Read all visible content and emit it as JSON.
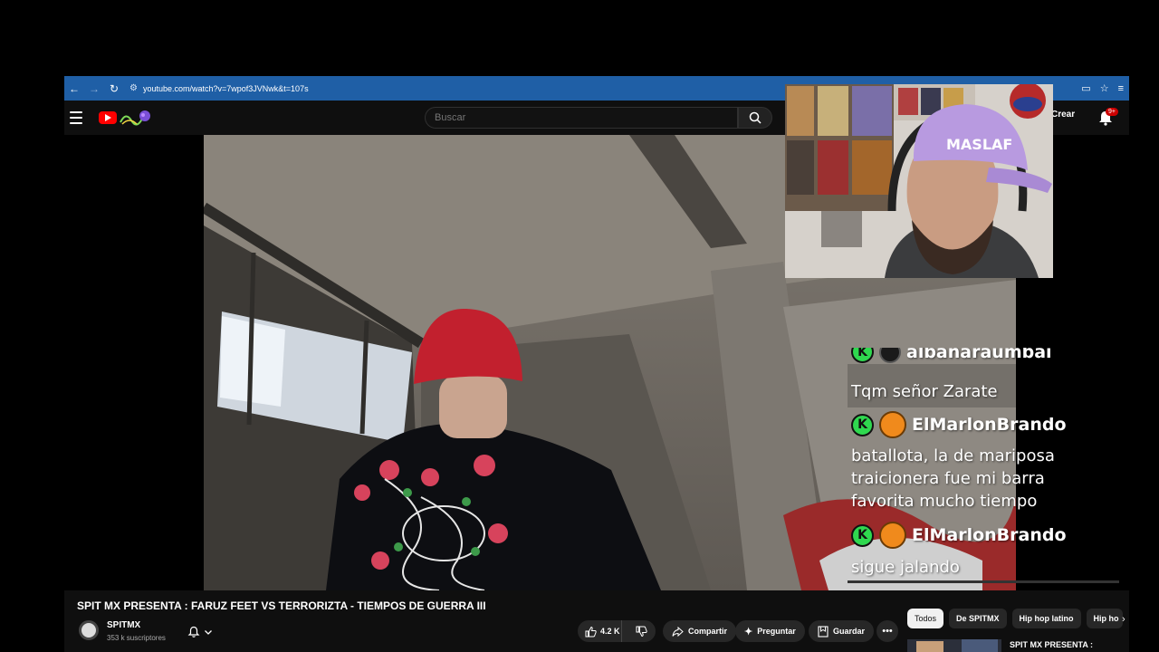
{
  "browser": {
    "url": "youtube.com/watch?v=7wpof3JVNwk&t=107s",
    "back_icon": "arrow-left-icon",
    "forward_icon": "arrow-right-icon",
    "reload_icon": "reload-icon"
  },
  "header": {
    "search_placeholder": "Buscar",
    "create_label": "Crear",
    "notifications_badge": "9+"
  },
  "chat": {
    "partial_top_user": "albanaraumbai",
    "messages": [
      {
        "text": "Tqm señor Zarate"
      },
      {
        "user": "ElMarlonBrando",
        "lines": [
          "batallota, la de mariposa",
          "traicionera fue mi barra",
          "favorita mucho tiempo"
        ]
      },
      {
        "user": "ElMarlonBrando",
        "lines": [
          "sigue jalando"
        ]
      }
    ],
    "kick_badge_letter": "K"
  },
  "webcam": {
    "cap_text": "MASLAF"
  },
  "video_info": {
    "title": "SPIT MX PRESENTA : FARUZ FEET VS TERRORIZTA - TIEMPOS DE GUERRA III",
    "channel_name": "SPITMX",
    "subscribers": "353 k suscriptores",
    "likes": "4.2 K",
    "share_label": "Compartir",
    "ask_label": "Preguntar",
    "save_label": "Guardar"
  },
  "chips": [
    "Todos",
    "De SPITMX",
    "Hip hop latino",
    "Hip ho"
  ],
  "recommendation": {
    "title": "SPIT MX PRESENTA :"
  },
  "colors": {
    "browser_bar": "#1f5fa6",
    "youtube_red": "#ff0000",
    "kick_green": "#2fd84f",
    "yt_dark": "#0f0f0f"
  }
}
